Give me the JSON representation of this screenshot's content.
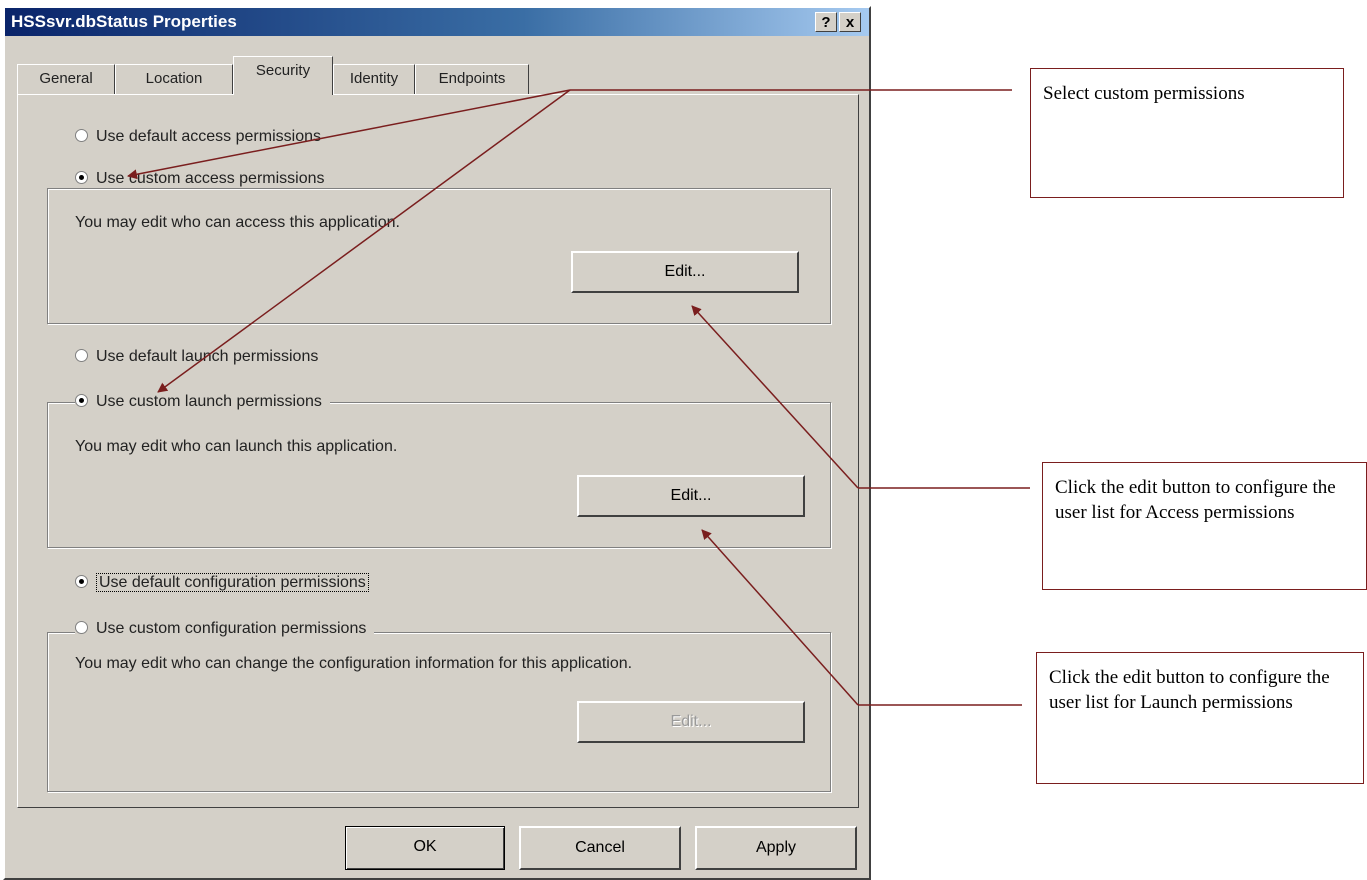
{
  "dialog": {
    "title": "HSSsvr.dbStatus Properties",
    "help_button": "?",
    "close_button": "x"
  },
  "tabs": [
    {
      "label": "General"
    },
    {
      "label": "Location"
    },
    {
      "label": "Security",
      "active": true
    },
    {
      "label": "Identity"
    },
    {
      "label": "Endpoints"
    }
  ],
  "access": {
    "default_label": "Use default access permissions",
    "custom_label": "Use custom access permissions",
    "selected": "custom",
    "hint": "You may edit who can access this application.",
    "edit_label": "Edit..."
  },
  "launch": {
    "default_label": "Use default launch permissions",
    "custom_label": "Use custom launch permissions",
    "selected": "custom",
    "hint": "You may edit who can launch this application.",
    "edit_label": "Edit..."
  },
  "configuration": {
    "default_label": "Use default configuration permissions",
    "custom_label": "Use custom configuration permissions",
    "selected": "default",
    "hint": "You may edit who can change the configuration information for this application.",
    "edit_label": "Edit..."
  },
  "footer": {
    "ok_label": "OK",
    "cancel_label": "Cancel",
    "apply_label": "Apply"
  },
  "callouts": {
    "select_custom": "Select custom permissions",
    "access_edit": "Click the edit button to configure the user list for Access permissions",
    "launch_edit": "Click the edit button to configure the user list for Launch permissions"
  },
  "colors": {
    "dialog_bg": "#d4d0c8",
    "title_bar": "#0a246a",
    "arrow": "#7a1e1e"
  }
}
